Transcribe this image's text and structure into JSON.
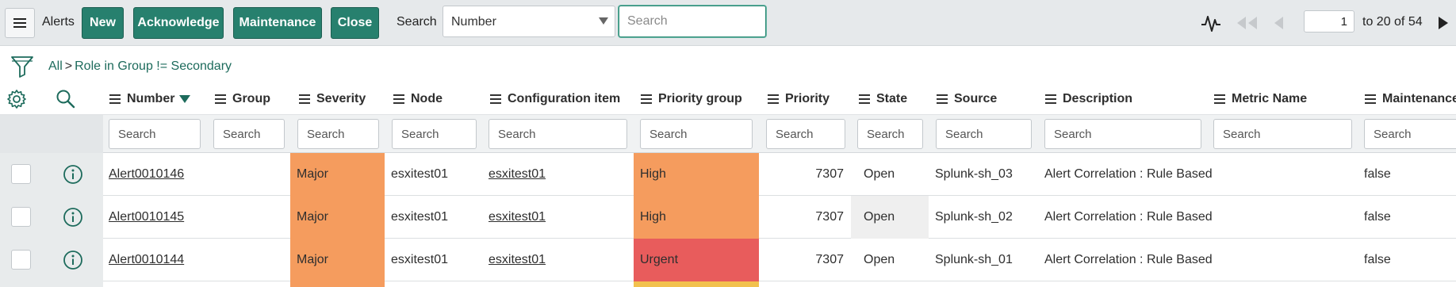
{
  "toolbar": {
    "title": "Alerts",
    "buttons": [
      "New",
      "Acknowledge",
      "Maintenance",
      "Close"
    ],
    "search_label": "Search",
    "search_field": "Number",
    "search_placeholder": "Search",
    "page_current": "1",
    "page_range": "to 20 of 54"
  },
  "breadcrumb": {
    "all": "All",
    "separator": ">",
    "condition": "Role in Group != Secondary"
  },
  "columns": [
    "Number",
    "Group",
    "Severity",
    "Node",
    "Configuration item",
    "Priority group",
    "Priority",
    "State",
    "Source",
    "Description",
    "Metric Name",
    "Maintenance"
  ],
  "sorted_column": "Number",
  "column_search_placeholder": "Search",
  "rows": [
    {
      "number": "Alert0010146",
      "group": "",
      "severity": "Major",
      "node": "esxitest01",
      "ci": "esxitest01",
      "priority_group": "High",
      "priority": "7307",
      "state": "Open",
      "source": "Splunk-sh_03",
      "description": "Alert Correlation : Rule Based",
      "metric": "",
      "maintenance": "false"
    },
    {
      "number": "Alert0010145",
      "group": "",
      "severity": "Major",
      "node": "esxitest01",
      "ci": "esxitest01",
      "priority_group": "High",
      "priority": "7307",
      "state": "Open",
      "source": "Splunk-sh_02",
      "description": "Alert Correlation : Rule Based",
      "metric": "",
      "maintenance": "false"
    },
    {
      "number": "Alert0010144",
      "group": "",
      "severity": "Major",
      "node": "esxitest01",
      "ci": "esxitest01",
      "priority_group": "Urgent",
      "priority": "7307",
      "state": "Open",
      "source": "Splunk-sh_01",
      "description": "Alert Correlation : Rule Based",
      "metric": "",
      "maintenance": "false"
    }
  ],
  "colors": {
    "button": "#27806e",
    "link": "#1d6b5c",
    "severity_major": "#f59c5e",
    "priority_high": "#f59c5e",
    "priority_urgent": "#e85c5c",
    "priority_next": "#f2c14e"
  },
  "icons": [
    "menu-icon",
    "filter-icon",
    "gear-icon",
    "search-icon",
    "activity-icon",
    "first-page-icon",
    "prev-page-icon",
    "next-page-icon",
    "info-icon"
  ]
}
